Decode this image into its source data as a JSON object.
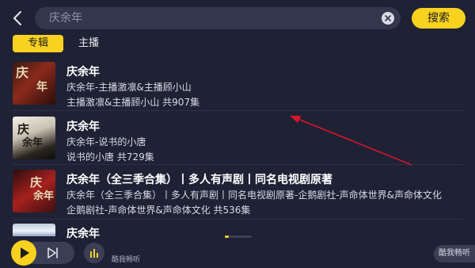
{
  "header": {
    "search_value": "庆余年",
    "search_button_label": "搜索"
  },
  "tabs": [
    {
      "label": "专辑",
      "active": true
    },
    {
      "label": "主播",
      "active": false
    }
  ],
  "results": [
    {
      "title": "庆余年",
      "subtitle": "庆余年-主播激凛&主播顾小山",
      "meta": "主播激凛&主播顾小山   共907集"
    },
    {
      "title": "庆余年",
      "subtitle": "庆余年-说书的小唐",
      "meta": "说书的小唐   共729集"
    },
    {
      "title": "庆余年（全三季合集）丨多人有声剧丨同名电视剧原著",
      "subtitle": "庆余年（全三季合集）丨多人有声剧丨同名电视剧原著-企鹅剧社-声命体世界&声命体文化",
      "meta": "企鹅剧社-声命体世界&声命体文化   共536集"
    },
    {
      "title": "庆余年",
      "subtitle": "",
      "meta": ""
    }
  ],
  "player": {
    "label": "酷我畅听",
    "progress": 0.15
  },
  "brand_label": "酷我畅听",
  "colors": {
    "accent": "#f9d21f",
    "background": "#1f2235",
    "annotation_arrow": "#d9162a"
  }
}
